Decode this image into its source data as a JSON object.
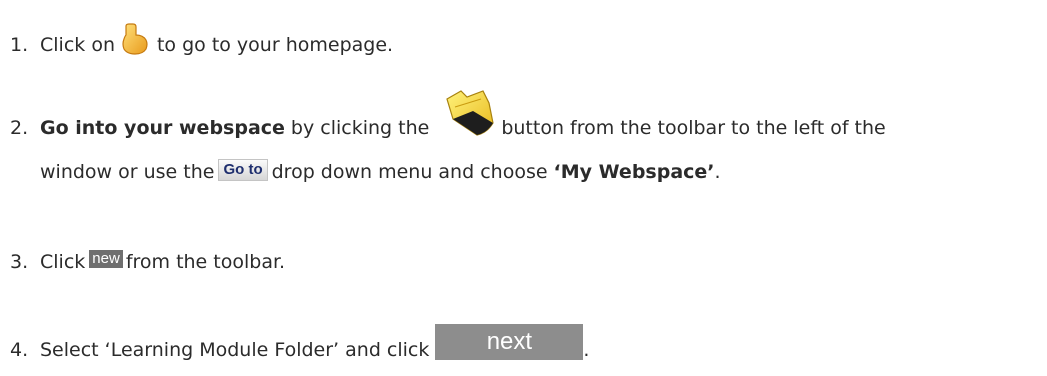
{
  "steps": [
    {
      "number": "1.",
      "text_before": "Click on",
      "icon": "home-icon",
      "text_after": "to go to your homepage."
    },
    {
      "number": "2.",
      "bold_intro": "Go into your webspace",
      "text_before": "by clicking the",
      "icon": "folder-icon",
      "text_after": "button from the toolbar to the left of the",
      "line2_before": "window or use the",
      "goto_label": "Go to",
      "line2_middle": "drop down menu and choose",
      "bold_choice": "‘My Webspace’",
      "line2_end": "."
    },
    {
      "number": "3.",
      "text_before": "Click",
      "new_label": "new",
      "text_after": "from the toolbar."
    },
    {
      "number": "4.",
      "text_before": "Select ‘Learning Module Folder’ and click",
      "next_label": "next",
      "text_after": "."
    }
  ],
  "colors": {
    "text": "#2b2b2b",
    "home_icon_fill": "#f2b233",
    "folder_icon_fill": "#f5d335",
    "next_button_bg": "#8d8d8d",
    "new_badge_bg": "#6f6f6f",
    "goto_text": "#1f2f6e"
  }
}
